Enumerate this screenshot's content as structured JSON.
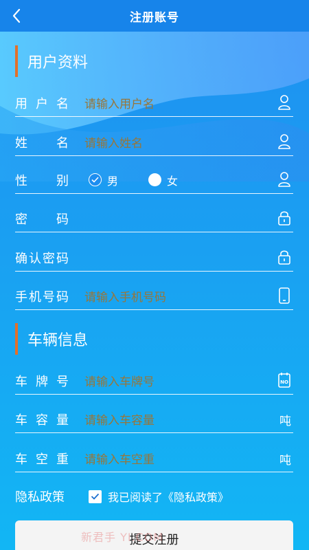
{
  "header": {
    "title": "注册账号",
    "back_icon": "chevron-left-icon"
  },
  "sections": {
    "user_profile": "用户资料",
    "vehicle_info": "车辆信息"
  },
  "fields": {
    "username": {
      "label": "用户名",
      "placeholder": "请输入用户名",
      "icon": "person-icon"
    },
    "name": {
      "label": "姓名",
      "placeholder": "请输入姓名",
      "icon": "person-icon"
    },
    "gender": {
      "label": "性别",
      "options": [
        "男",
        "女"
      ],
      "selected": "男",
      "icon": "person-icon"
    },
    "password": {
      "label": "密码",
      "placeholder": "",
      "icon": "lock-icon"
    },
    "confirm_password": {
      "label": "确认密码",
      "placeholder": "",
      "icon": "lock-icon"
    },
    "phone": {
      "label": "手机号码",
      "placeholder": "请输入手机号码",
      "icon": "phone-icon"
    },
    "plate": {
      "label": "车牌号",
      "placeholder": "请输入车牌号",
      "icon": "license-plate-icon",
      "icon_text": "NO"
    },
    "capacity": {
      "label": "车容量",
      "placeholder": "请输入车容量",
      "unit": "吨"
    },
    "empty_weight": {
      "label": "车空重",
      "placeholder": "请输入车空重",
      "unit": "吨"
    },
    "privacy": {
      "label": "隐私政策",
      "text": "我已阅读了《隐私政策》",
      "checked": true
    }
  },
  "submit_label": "提交注册",
  "watermark": "新君手 YI.COM",
  "colors": {
    "accent_bar": "#e2702a",
    "nav_bg": "#1784ea",
    "placeholder": "#97763a"
  }
}
